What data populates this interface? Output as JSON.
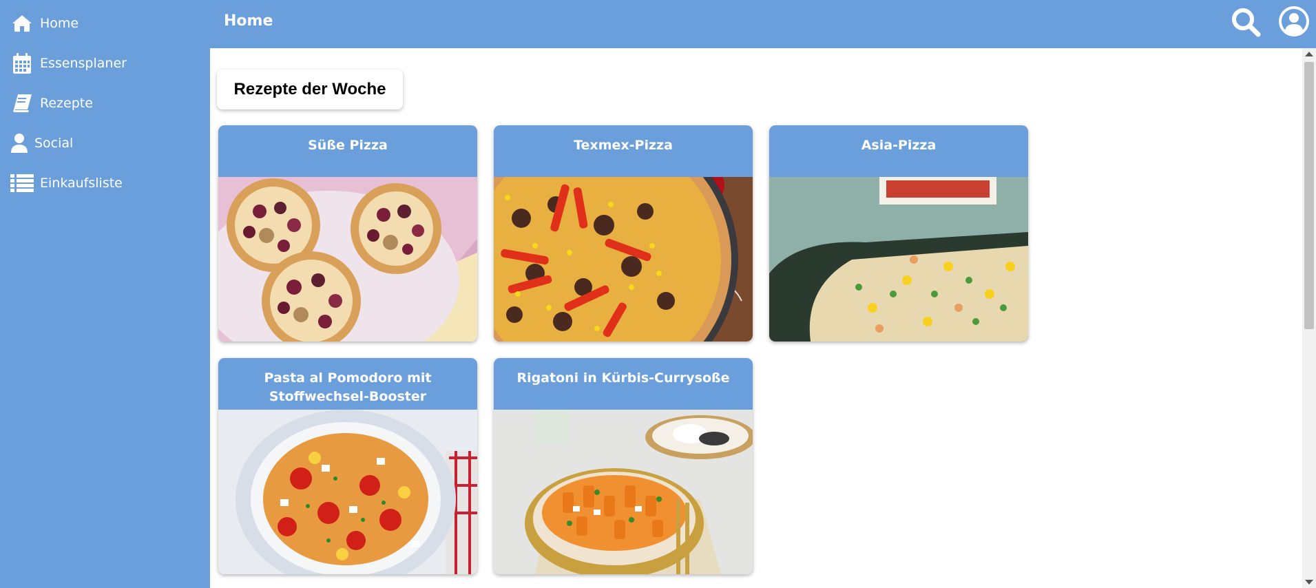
{
  "colors": {
    "primary": "#6a9fdc",
    "background": "#ffffff",
    "text_on_primary": "#ffffff"
  },
  "sidebar": {
    "items": [
      {
        "label": "Home",
        "icon": "home-icon"
      },
      {
        "label": "Essensplaner",
        "icon": "calendar-icon"
      },
      {
        "label": "Rezepte",
        "icon": "book-icon"
      },
      {
        "label": "Social",
        "icon": "user-icon"
      },
      {
        "label": "Einkaufsliste",
        "icon": "list-icon"
      }
    ]
  },
  "header": {
    "title": "Home",
    "search_icon": "search-icon",
    "account_icon": "account-icon"
  },
  "main": {
    "section_title": "Rezepte der Woche",
    "recipes": [
      {
        "title": "Süße Pizza"
      },
      {
        "title": "Texmex-Pizza"
      },
      {
        "title": "Asia-Pizza"
      },
      {
        "title": "Pasta al Pomodoro mit Stoffwechsel-Booster"
      },
      {
        "title": "Rigatoni in Kürbis-Currysoße"
      }
    ]
  }
}
